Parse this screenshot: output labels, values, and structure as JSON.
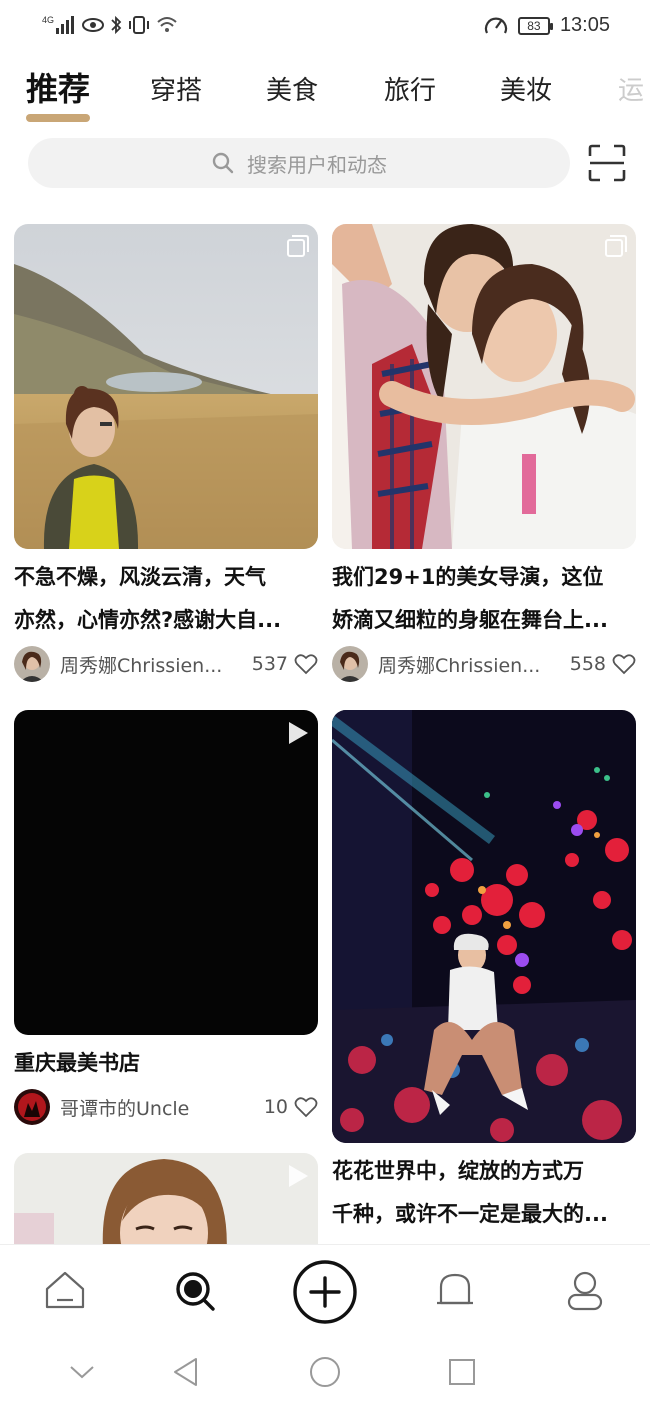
{
  "status_bar": {
    "network": "4G",
    "battery": "83",
    "time": "13:05"
  },
  "tabs": [
    {
      "label": "推荐",
      "active": true
    },
    {
      "label": "穿搭"
    },
    {
      "label": "美食"
    },
    {
      "label": "旅行"
    },
    {
      "label": "美妆"
    },
    {
      "label": "运"
    }
  ],
  "search": {
    "placeholder": "搜索用户和动态"
  },
  "cards": [
    {
      "title_line1": "不急不燥，风淡云清，天气",
      "title_line2": "亦然，心情亦然?感谢大自...",
      "author": "周秀娜Chrissien...",
      "likes": "537",
      "badge": "multi-image-icon"
    },
    {
      "title_line1": "我们29+1的美女导演，这位",
      "title_line2": "娇滴又细粒的身躯在舞台上...",
      "author": "周秀娜Chrissien...",
      "likes": "558",
      "badge": "multi-image-icon"
    },
    {
      "title_line1": "重庆最美书店",
      "author": "哥谭市的Uncle",
      "likes": "10",
      "badge": "video-play-icon"
    },
    {
      "title_line1": "花花世界中，绽放的方式万",
      "title_line2": "千种，或许不一定是最大的...",
      "badge": "none"
    },
    {
      "badge": "video-play-icon"
    }
  ],
  "colors": {
    "accent": "#c9a676",
    "search_bg": "#f2f2f2",
    "text": "#111111",
    "muted": "#555555"
  },
  "bottom_nav": [
    "home-icon",
    "discover-icon",
    "add-icon",
    "notification-bell-icon",
    "profile-icon"
  ],
  "system_nav": [
    "collapse-icon",
    "back-icon",
    "home-circle-icon",
    "recents-icon"
  ]
}
